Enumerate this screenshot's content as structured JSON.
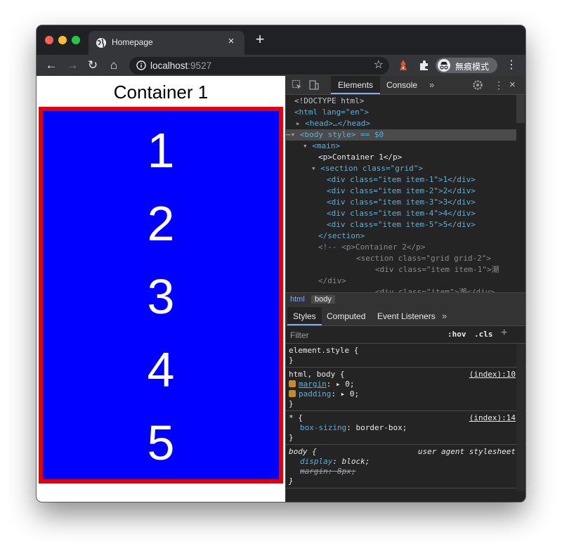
{
  "browser": {
    "tab_title": "Homepage",
    "tab_close": "×",
    "new_tab": "+",
    "url_host": "localhost",
    "url_port": ":9527",
    "star": "☆",
    "profile_label": "無痕模式",
    "menu": "⋮",
    "back": "←",
    "forward": "→",
    "reload": "↻",
    "home": "⌂"
  },
  "page": {
    "container_title": "Container 1",
    "items": [
      "1",
      "2",
      "3",
      "4",
      "5"
    ],
    "colors": {
      "grid_bg": "#0000ff",
      "grid_border": "#e60000"
    }
  },
  "devtools": {
    "tabs": {
      "elements": "Elements",
      "console": "Console",
      "more": "»"
    },
    "dom_lines": [
      "<!DOCTYPE html>",
      "<html lang=\"en\">",
      "<head>…</head>",
      "<body style> == $0",
      "<main>",
      "<p>Container 1</p>",
      "<section class=\"grid\">",
      "<div class=\"item item-1\">1</div>",
      "<div class=\"item item-2\">2</div>",
      "<div class=\"item item-3\">3</div>",
      "<div class=\"item item-4\">4</div>",
      "<div class=\"item item-5\">5</div>",
      "</section>",
      "<!-- <p>Container 2</p>",
      "<section class=\"grid grid-2\">",
      "<div class=\"item item-1\">潮",
      "</div>",
      "<div class=\"item\">潮</div>"
    ],
    "breadcrumbs": {
      "html": "html",
      "body": "body"
    },
    "styles_tabs": {
      "styles": "Styles",
      "computed": "Computed",
      "listeners": "Event Listeners",
      "more": "»"
    },
    "filter_placeholder": "Filter",
    "hov": ":hov",
    "cls": ".cls",
    "plus": "+",
    "rules": {
      "element_style": {
        "selector": "element.style {",
        "close": "}"
      },
      "html_body": {
        "selector": "html, body {",
        "source": "(index):10",
        "margin_prop": "margin",
        "margin_val": "▸ 0;",
        "padding_prop": "padding",
        "padding_val": "▸ 0;",
        "close": "}"
      },
      "star": {
        "selector": "* {",
        "source": "(index):14",
        "prop": "box-sizing",
        "val": " border-box;",
        "close": "}"
      },
      "body_ua": {
        "selector": "body {",
        "source": "user agent stylesheet",
        "display_prop": "display",
        "display_val": " block;",
        "margin_prop": "margin",
        "margin_val": " 8px;",
        "close": "}"
      }
    }
  }
}
